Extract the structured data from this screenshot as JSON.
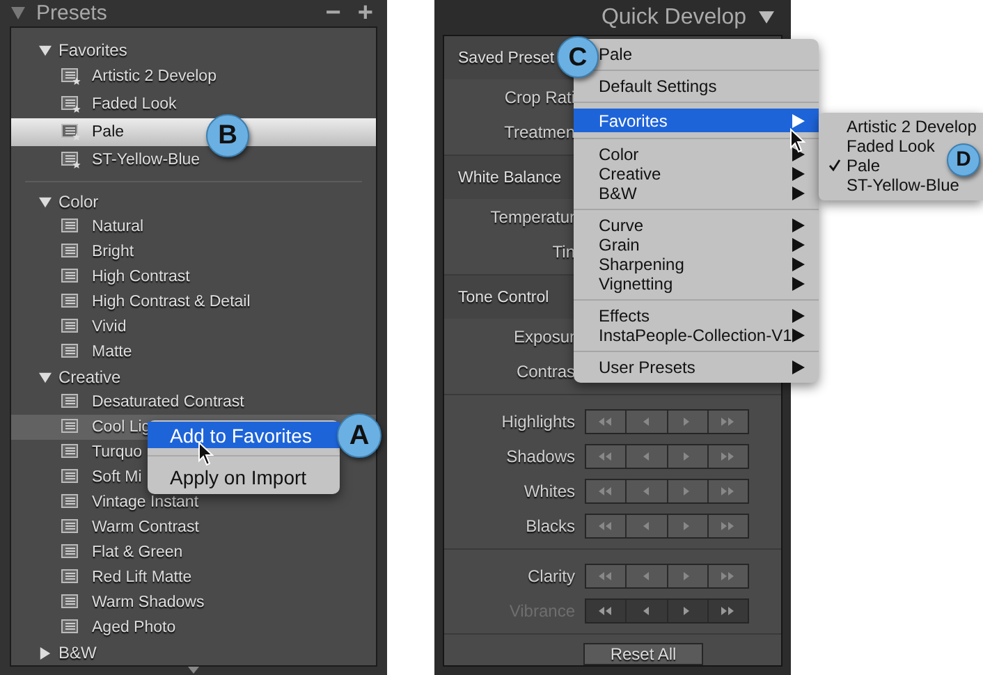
{
  "presets_panel": {
    "title": "Presets",
    "remove_button": "−",
    "add_button": "+",
    "groups": [
      {
        "name": "Favorites",
        "kind": "favorites",
        "expanded": true,
        "items": [
          {
            "label": "Artistic 2 Develop",
            "selected": false,
            "context_target": false
          },
          {
            "label": "Faded Look",
            "selected": false,
            "context_target": false
          },
          {
            "label": "Pale",
            "selected": true,
            "context_target": false,
            "callout": "B"
          },
          {
            "label": "ST-Yellow-Blue",
            "selected": false,
            "context_target": false
          }
        ]
      },
      {
        "name": "Color",
        "kind": "folder",
        "expanded": true,
        "items": [
          {
            "label": "Natural",
            "selected": false,
            "context_target": false
          },
          {
            "label": "Bright",
            "selected": false,
            "context_target": false
          },
          {
            "label": "High Contrast",
            "selected": false,
            "context_target": false
          },
          {
            "label": "High Contrast & Detail",
            "selected": false,
            "context_target": false
          },
          {
            "label": "Vivid",
            "selected": false,
            "context_target": false
          },
          {
            "label": "Matte",
            "selected": false,
            "context_target": false
          }
        ]
      },
      {
        "name": "Creative",
        "kind": "folder",
        "expanded": true,
        "items": [
          {
            "label": "Desaturated Contrast",
            "selected": false,
            "context_target": false
          },
          {
            "label": "Cool Lig",
            "selected": false,
            "context_target": true
          },
          {
            "label": "Turquo",
            "selected": false,
            "context_target": false
          },
          {
            "label": "Soft Mi",
            "selected": false,
            "context_target": false
          },
          {
            "label": "Vintage Instant",
            "selected": false,
            "context_target": false
          },
          {
            "label": "Warm Contrast",
            "selected": false,
            "context_target": false
          },
          {
            "label": "Flat & Green",
            "selected": false,
            "context_target": false
          },
          {
            "label": "Red Lift Matte",
            "selected": false,
            "context_target": false
          },
          {
            "label": "Warm Shadows",
            "selected": false,
            "context_target": false
          },
          {
            "label": "Aged Photo",
            "selected": false,
            "context_target": false
          }
        ]
      },
      {
        "name": "B&W",
        "kind": "folder",
        "expanded": false
      }
    ]
  },
  "context_menu": {
    "callout": "A",
    "items": [
      {
        "label": "Add to Favorites",
        "selected": true
      },
      {
        "label": "Apply on Import",
        "selected": false
      }
    ]
  },
  "quick_develop": {
    "title": "Quick Develop",
    "sections": [
      {
        "title": "Saved Preset",
        "rows": [
          {
            "label": "Crop Rati",
            "kind": "label"
          },
          {
            "label": "Treatmen",
            "kind": "label"
          }
        ]
      },
      {
        "title": "White Balance",
        "rows": [
          {
            "label": "Temperatur",
            "kind": "label"
          },
          {
            "label": "Tin",
            "kind": "label"
          }
        ]
      },
      {
        "title": "Tone Control",
        "rows": [
          {
            "label": "Exposur",
            "kind": "label"
          },
          {
            "label": "Contras",
            "kind": "label"
          }
        ]
      },
      {
        "rows": [
          {
            "label": "Highlights",
            "kind": "stepper",
            "disabled": false
          },
          {
            "label": "Shadows",
            "kind": "stepper",
            "disabled": false
          },
          {
            "label": "Whites",
            "kind": "stepper",
            "disabled": false
          },
          {
            "label": "Blacks",
            "kind": "stepper",
            "disabled": false
          }
        ]
      },
      {
        "rows": [
          {
            "label": "Clarity",
            "kind": "stepper",
            "disabled": false
          },
          {
            "label": "Vibrance",
            "kind": "stepper",
            "disabled": true
          }
        ]
      }
    ],
    "reset_button": "Reset All"
  },
  "preset_menu": {
    "callout": "C",
    "groups": [
      {
        "items": [
          {
            "label": "Pale",
            "has_submenu": false,
            "selected": false
          }
        ]
      },
      {
        "items": [
          {
            "label": "Default Settings",
            "has_submenu": false,
            "selected": false
          }
        ]
      },
      {
        "items": [
          {
            "label": "Favorites",
            "has_submenu": true,
            "selected": true
          }
        ]
      },
      {
        "items": [
          {
            "label": "Color",
            "has_submenu": true,
            "selected": false
          },
          {
            "label": "Creative",
            "has_submenu": true,
            "selected": false
          },
          {
            "label": "B&W",
            "has_submenu": true,
            "selected": false
          }
        ]
      },
      {
        "items": [
          {
            "label": "Curve",
            "has_submenu": true,
            "selected": false
          },
          {
            "label": "Grain",
            "has_submenu": true,
            "selected": false
          },
          {
            "label": "Sharpening",
            "has_submenu": true,
            "selected": false
          },
          {
            "label": "Vignetting",
            "has_submenu": true,
            "selected": false
          }
        ]
      },
      {
        "items": [
          {
            "label": "Effects",
            "has_submenu": true,
            "selected": false
          },
          {
            "label": "InstaPeople-Collection-V1",
            "has_submenu": true,
            "selected": false
          }
        ]
      },
      {
        "items": [
          {
            "label": "User Presets",
            "has_submenu": true,
            "selected": false
          }
        ]
      }
    ]
  },
  "submenu": {
    "callout": "D",
    "items": [
      {
        "label": "Artistic 2 Develop",
        "checked": false
      },
      {
        "label": "Faded Look",
        "checked": false
      },
      {
        "label": "Pale",
        "checked": true
      },
      {
        "label": "ST-Yellow-Blue",
        "checked": false
      }
    ]
  }
}
